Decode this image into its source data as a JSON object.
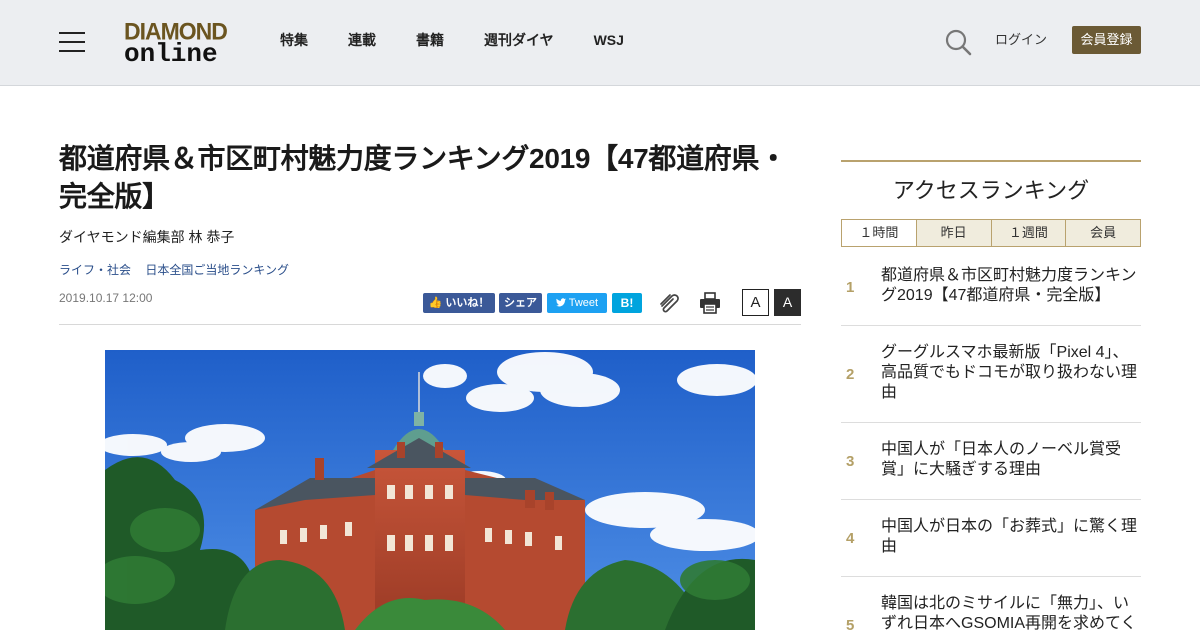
{
  "header": {
    "logo_top": "DIAMOND",
    "logo_bottom": "online",
    "nav": [
      "特集",
      "連載",
      "書籍",
      "週刊ダイヤ",
      "WSJ"
    ],
    "login": "ログイン",
    "register": "会員登録"
  },
  "article": {
    "title": "都道府県＆市区町村魅力度ランキング2019【47都道府県・完全版】",
    "author": "ダイヤモンド編集部 林 恭子",
    "tags": [
      "ライフ・社会",
      "日本全国ご当地ランキング"
    ],
    "date": "2019.10.17 12:00",
    "share": {
      "like": "いいね！",
      "facebook": "シェア",
      "twitter": "Tweet",
      "hatena": "B!"
    },
    "font_small": "A",
    "font_large": "A"
  },
  "sidebar": {
    "title": "アクセスランキング",
    "tabs": [
      "１時間",
      "昨日",
      "１週間",
      "会員"
    ],
    "ranking": [
      {
        "rank": "1",
        "text": "都道府県＆市区町村魅力度ランキング2019【47都道府県・完全版】"
      },
      {
        "rank": "2",
        "text": "グーグルスマホ最新版「Pixel 4」、高品質でもドコモが取り扱わない理由"
      },
      {
        "rank": "3",
        "text": "中国人が「日本人のノーベル賞受賞」に大騒ぎする理由"
      },
      {
        "rank": "4",
        "text": "中国人が日本の「お葬式」に驚く理由"
      },
      {
        "rank": "5",
        "text": "韓国は北のミサイルに「無力」、いずれ日本へGSOMIA再開を求めてくる"
      }
    ]
  },
  "colors": {
    "header_bg": "#eceef1",
    "brand_gold": "#6b5a35",
    "rank_gold": "#b4a067",
    "link_blue": "#2a4e8a"
  }
}
